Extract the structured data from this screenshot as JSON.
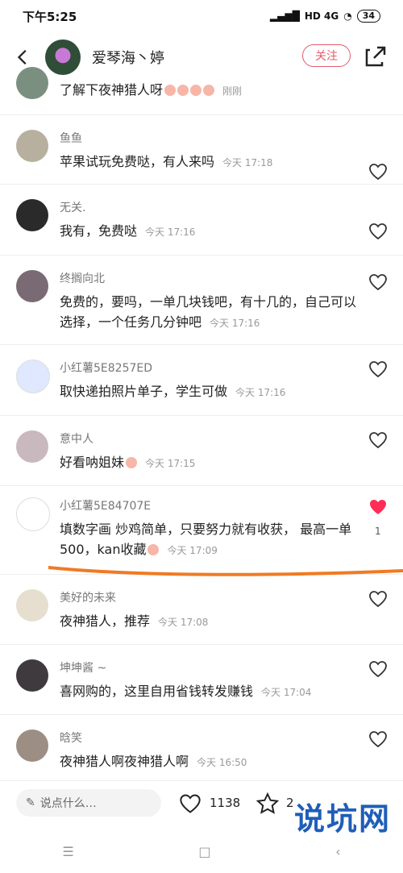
{
  "status": {
    "time": "下午5:25",
    "network": "HD 4G",
    "battery": "34"
  },
  "header": {
    "title": "爱琴海丶婷",
    "follow": "关注"
  },
  "comments": [
    {
      "name": "",
      "text": "了解下夜神猎人呀",
      "time": "刚刚"
    },
    {
      "name": "鱼鱼",
      "text": "苹果试玩免费哒，有人来吗",
      "time": "今天 17:18"
    },
    {
      "name": "无关.",
      "text": "我有，免费哒",
      "time": "今天 17:16"
    },
    {
      "name": "终搁向北",
      "text": "免费的，要吗，一单几块钱吧，有十几的，自己可以选择，一个任务几分钟吧",
      "time": "今天 17:16"
    },
    {
      "name": "小红薯5E8257ED",
      "text": "取快递拍照片单子，学生可做",
      "time": "今天 17:16"
    },
    {
      "name": "意中人",
      "text": "好看呐姐妹",
      "time": "今天 17:15"
    },
    {
      "name": "小红薯5E84707E",
      "text": "填数字画 炒鸡简单，只要努力就有收获， 最高一单500，kan收藏",
      "time": "今天 17:09",
      "likes": "1"
    },
    {
      "name": "美好的未来",
      "text": "夜神猎人，推荐",
      "time": "今天 17:08"
    },
    {
      "name": "坤坤酱 ~",
      "text": "喜网购的，这里自用省钱转发赚钱",
      "time": "今天 17:04"
    },
    {
      "name": "晗笑",
      "text": "夜神猎人啊夜神猎人啊",
      "time": "今天 16:50"
    }
  ],
  "bottom": {
    "placeholder": "说点什么…",
    "likes": "1138",
    "stars": "2"
  },
  "watermark": "说坑网"
}
